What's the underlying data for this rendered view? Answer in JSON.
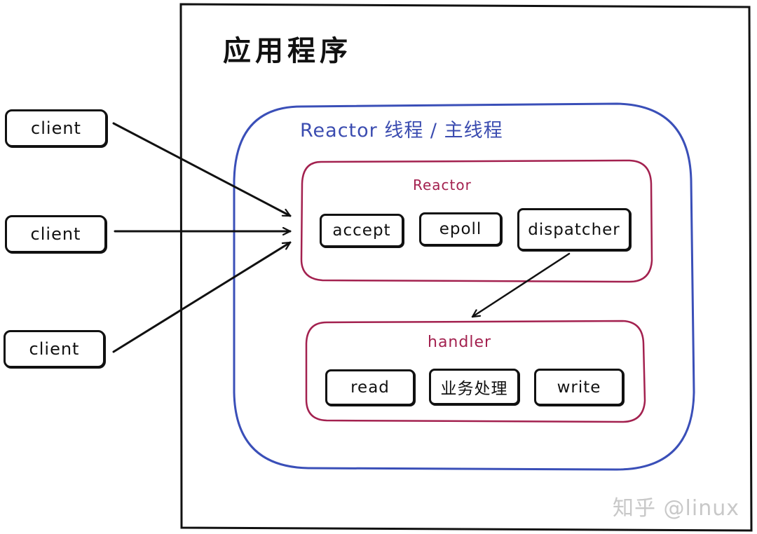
{
  "app": {
    "title": "应用程序"
  },
  "thread": {
    "title": "Reactor 线程 / 主线程"
  },
  "reactor": {
    "title": "Reactor",
    "modules": [
      "accept",
      "epoll",
      "dispatcher"
    ]
  },
  "handler": {
    "title": "handler",
    "modules": [
      "read",
      "业务处理",
      "write"
    ]
  },
  "clients": [
    "client",
    "client",
    "client"
  ],
  "watermark": "知乎 @linux",
  "colors": {
    "outline": "#111111",
    "thread_border": "#3a4fb8",
    "thread_text": "#3b4cb0",
    "reactor_border": "#a3214f",
    "reactor_text": "#a3214f",
    "watermark": "#c8c8c8"
  }
}
